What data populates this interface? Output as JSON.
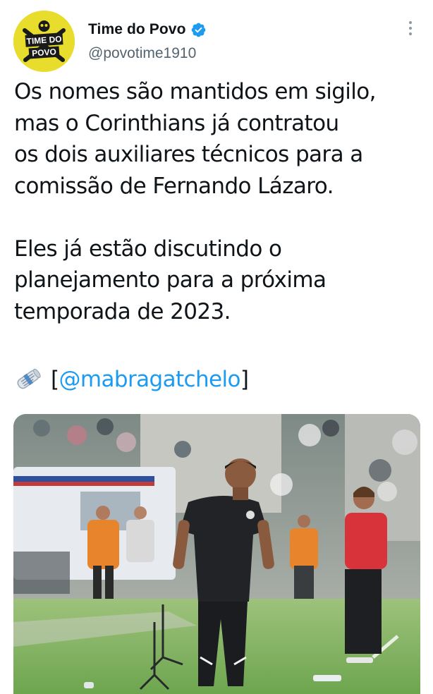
{
  "account": {
    "display_name": "Time do Povo",
    "handle": "@povotime1910",
    "verified": true,
    "avatar_text": [
      "TIME DO",
      "POVO"
    ]
  },
  "tweet": {
    "paragraphs": [
      [
        "Os nomes são mantidos em sigilo,",
        "mas o Corinthians já contratou",
        "os dois auxiliares técnicos para a",
        "comissão de Fernando Lázaro."
      ],
      [
        "Eles já estão discutindo o",
        "planejamento para a próxima",
        "temporada de 2023."
      ]
    ],
    "source_open": "[",
    "source_mention": "@mabragatchelo",
    "source_close": "]"
  },
  "icons": {
    "verified": "verified-badge-icon",
    "more": "more-options-icon",
    "source": "rolled-newspaper-icon"
  },
  "colors": {
    "link": "#1d9bf0",
    "verified": "#1d9bf0",
    "text": "#0f1419",
    "secondary": "#536471",
    "avatar_bg": "#e8dd2c"
  }
}
